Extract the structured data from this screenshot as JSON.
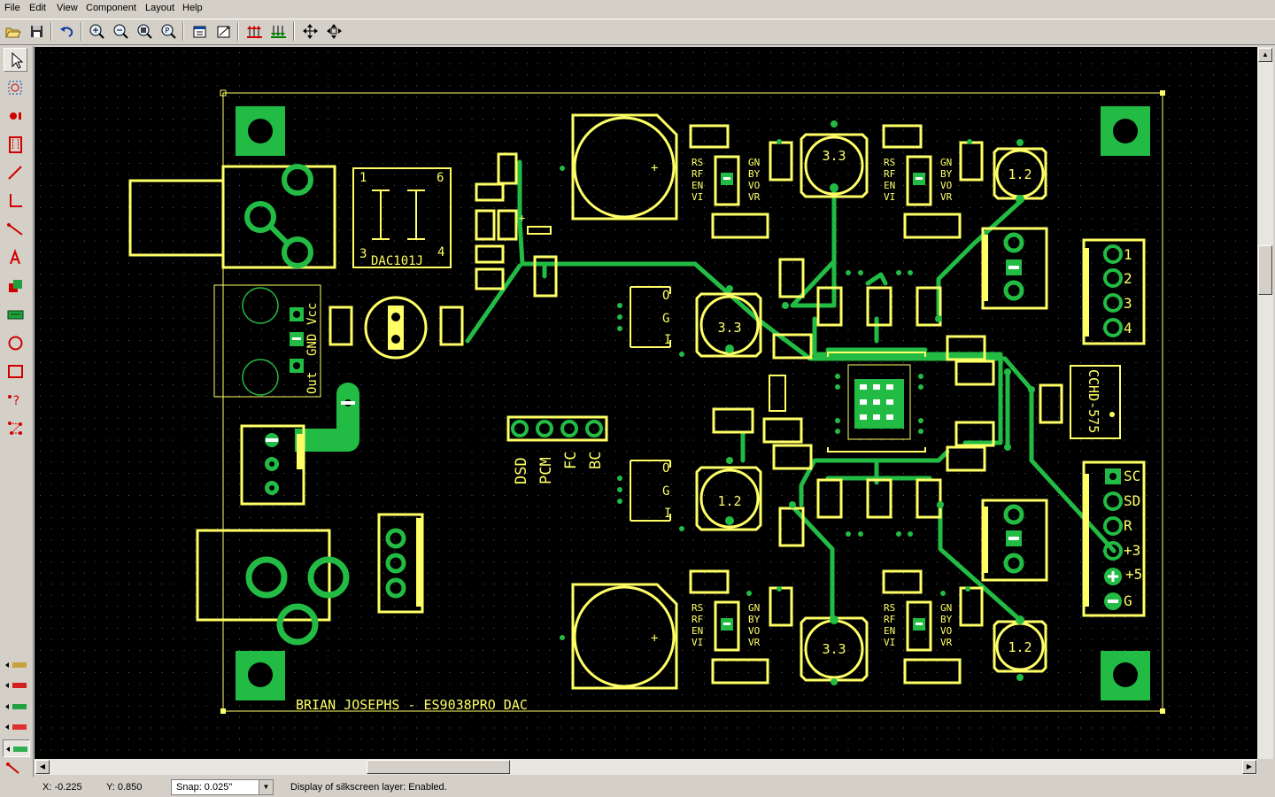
{
  "menu": [
    "File",
    "Edit",
    "View",
    "Component",
    "Layout",
    "Help"
  ],
  "toolbar_icons": [
    "open-folder-icon",
    "save-icon",
    "undo-icon",
    "zoom-in-icon",
    "zoom-out-icon",
    "zoom-window-icon",
    "zoom-fit-icon",
    "properties-icon",
    "design-rules-icon",
    "move-up-layer-icon",
    "move-down-layer-icon",
    "select-group-icon",
    "move-icon"
  ],
  "left_tools": [
    "select-tool",
    "zoom-area-tool",
    "pad-tool",
    "footprint-tool",
    "trace-tool",
    "corner-trace-tool",
    "ratline-tool",
    "text-tool",
    "area-tool",
    "copper-area-tool",
    "circle-tool",
    "rectangle-tool",
    "query-tool",
    "netlist-tool"
  ],
  "colors": {
    "silkscreen": "#ffff66",
    "copper": "#22bb44",
    "background": "#000000",
    "grid": "#606060"
  },
  "board": {
    "title": "BRIAN JOSEPHS - ES9038PRO DAC",
    "reg_labels": [
      "3.3",
      "3.3",
      "3.3",
      "3.3",
      "1.2",
      "1.2",
      "1.2",
      "1.2"
    ],
    "ic_label": "DAC101J",
    "ic_pins": [
      "1",
      "6",
      "3",
      "4"
    ],
    "power_labels": [
      "Out",
      "GND",
      "Vcc"
    ],
    "header4_labels": [
      "DSD",
      "PCM",
      "FC",
      "BC"
    ],
    "conn4_labels": [
      "1",
      "2",
      "3",
      "4"
    ],
    "conn6_labels": [
      "SC",
      "SD",
      "R",
      "+3",
      "+5",
      "G"
    ],
    "osc_label": "CCHD-575",
    "ogi_labels": [
      "O",
      "G",
      "I"
    ],
    "reg_pin_left": [
      "RS",
      "RF",
      "EN",
      "VI"
    ],
    "reg_pin_right": [
      "GN",
      "BY",
      "VO",
      "VR"
    ]
  },
  "status": {
    "x": "X: -0.225",
    "y": "Y: 0.850",
    "snap": "Snap:  0.025\"",
    "message": "Display of silkscreen layer:  Enabled."
  }
}
